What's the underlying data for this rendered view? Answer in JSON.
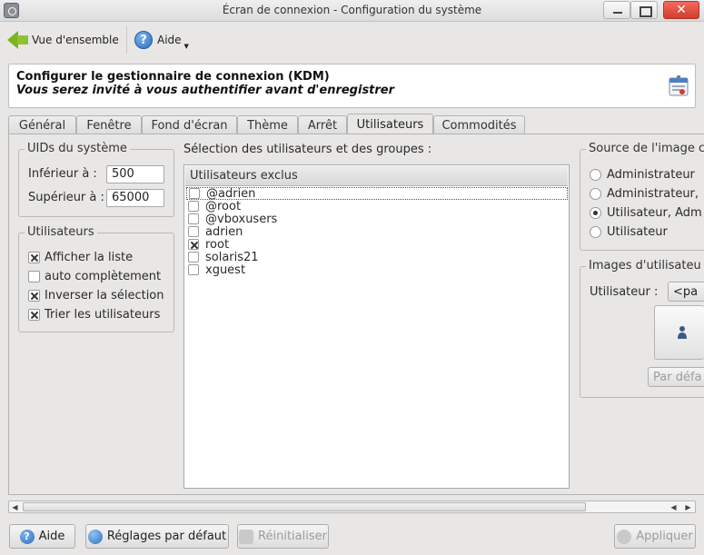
{
  "window": {
    "title": "Écran de connexion - Configuration du système"
  },
  "toolbar": {
    "overview_label": "Vue d'ensemble",
    "help_label": "Aide"
  },
  "header": {
    "title": "Configurer le gestionnaire de connexion (KDM)",
    "subtitle": "Vous serez invité à vous authentifier avant d'enregistrer"
  },
  "tabs": [
    "Général",
    "Fenêtre",
    "Fond d'écran",
    "Thème",
    "Arrêt",
    "Utilisateurs",
    "Commodités"
  ],
  "active_tab": "Utilisateurs",
  "uids": {
    "title": "UIDs du système",
    "lower_label": "Inférieur à :",
    "lower_value": "500",
    "upper_label": "Supérieur à :",
    "upper_value": "65000"
  },
  "users_group": {
    "title": "Utilisateurs",
    "options": [
      {
        "label": "Afficher la liste",
        "checked": true
      },
      {
        "label": "auto complètement",
        "checked": false
      },
      {
        "label": "Inverser la sélection",
        "checked": true
      },
      {
        "label": "Trier les utilisateurs",
        "checked": true
      }
    ]
  },
  "selection": {
    "title": "Sélection des utilisateurs et des groupes :",
    "column_header": "Utilisateurs exclus",
    "items": [
      {
        "name": "@adrien",
        "checked": false
      },
      {
        "name": "@root",
        "checked": false
      },
      {
        "name": "@vboxusers",
        "checked": false
      },
      {
        "name": "adrien",
        "checked": false
      },
      {
        "name": "root",
        "checked": true
      },
      {
        "name": "solaris21",
        "checked": false
      },
      {
        "name": "xguest",
        "checked": false
      }
    ]
  },
  "image_source": {
    "title": "Source de l'image c",
    "options": [
      {
        "label": "Administrateur",
        "checked": false
      },
      {
        "label": "Administrateur,",
        "checked": false
      },
      {
        "label": "Utilisateur, Adm",
        "checked": true
      },
      {
        "label": "Utilisateur",
        "checked": false
      }
    ]
  },
  "user_images": {
    "title": "Images d'utilisateu",
    "user_label": "Utilisateur :",
    "user_value": "<pa",
    "default_label": "Par défa"
  },
  "buttons": {
    "help": "Aide",
    "defaults": "Réglages par défaut",
    "reset": "Réinitialiser",
    "apply": "Appliquer"
  }
}
